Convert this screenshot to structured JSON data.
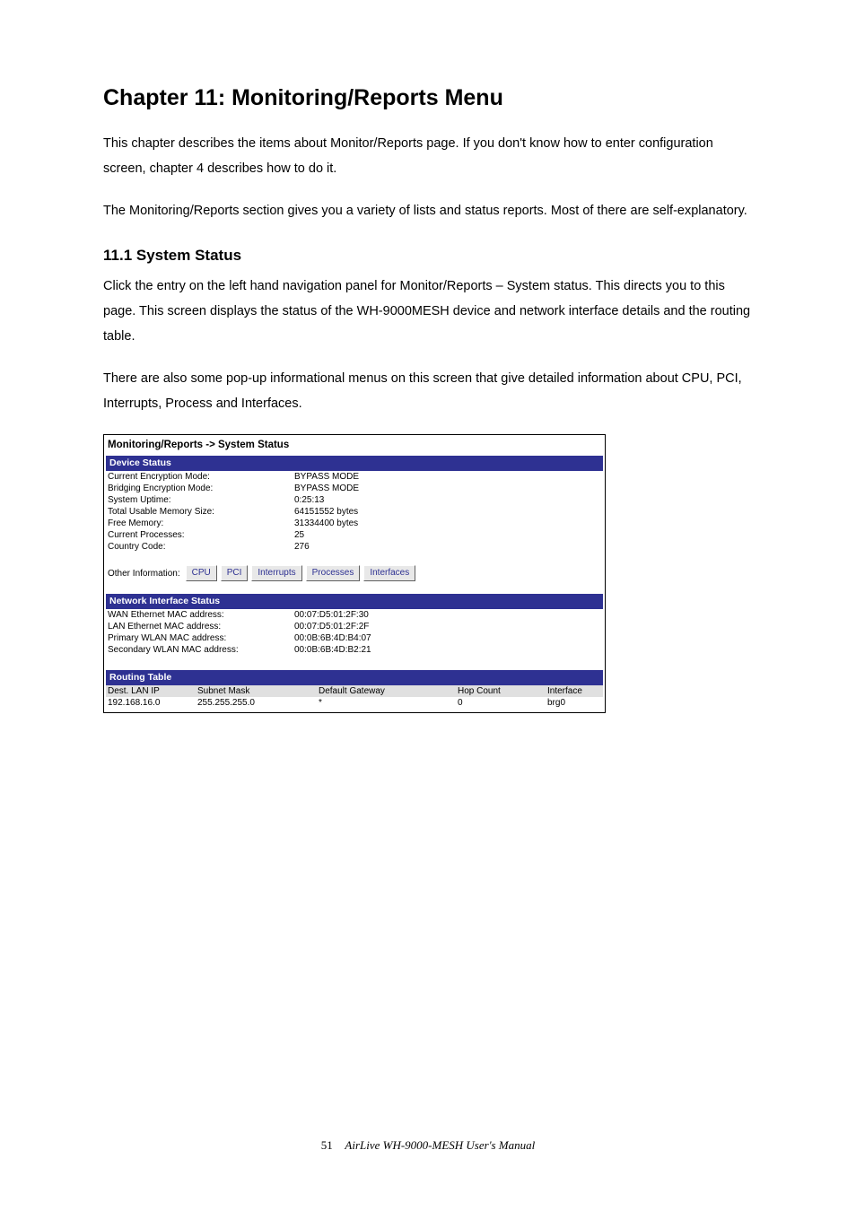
{
  "chapter_title": "Chapter 11: Monitoring/Reports Menu",
  "para1": "This chapter describes the items about Monitor/Reports page. If you don't know how to enter configuration screen, chapter 4 describes how to do it.",
  "para2": "The Monitoring/Reports section gives you a variety of lists and status reports. Most of there are self-explanatory.",
  "section_11_1_title": "11.1 System Status",
  "para3": "Click the entry on the left hand navigation panel for Monitor/Reports – System status. This directs you to this page. This screen displays the status of the WH-9000MESH device and network interface details and the routing table.",
  "para4": "There are also some pop-up informational menus on this screen that give detailed information about CPU, PCI, Interrupts, Process and Interfaces.",
  "screenshot": {
    "title": "Monitoring/Reports -> System Status",
    "device_status_header": "Device Status",
    "device_status": [
      {
        "label": "Current Encryption Mode:",
        "value": "BYPASS MODE"
      },
      {
        "label": "Bridging Encryption Mode:",
        "value": "BYPASS MODE"
      },
      {
        "label": "System Uptime:",
        "value": "0:25:13"
      },
      {
        "label": "Total Usable Memory Size:",
        "value": "64151552 bytes"
      },
      {
        "label": "Free Memory:",
        "value": "31334400 bytes"
      },
      {
        "label": "Current Processes:",
        "value": "25"
      },
      {
        "label": "Country Code:",
        "value": "276"
      }
    ],
    "other_info_label": "Other Information:",
    "buttons": [
      "CPU",
      "PCI",
      "Interrupts",
      "Processes",
      "Interfaces"
    ],
    "network_header": "Network Interface Status",
    "network_status": [
      {
        "label": "WAN Ethernet MAC address:",
        "value": "00:07:D5:01:2F:30"
      },
      {
        "label": "LAN Ethernet MAC address:",
        "value": "00:07:D5:01:2F:2F"
      },
      {
        "label": "Primary WLAN MAC address:",
        "value": "00:0B:6B:4D:B4:07"
      },
      {
        "label": "Secondary WLAN MAC address:",
        "value": "00:0B:6B:4D:B2:21"
      }
    ],
    "routing_header": "Routing Table",
    "routing_columns": [
      "Dest. LAN IP",
      "Subnet Mask",
      "Default Gateway",
      "Hop Count",
      "Interface"
    ],
    "routing_rows": [
      [
        "192.168.16.0",
        "255.255.255.0",
        "*",
        "0",
        "brg0"
      ]
    ]
  },
  "footer": {
    "page": "51",
    "text": "AirLive WH-9000-MESH User's Manual"
  }
}
